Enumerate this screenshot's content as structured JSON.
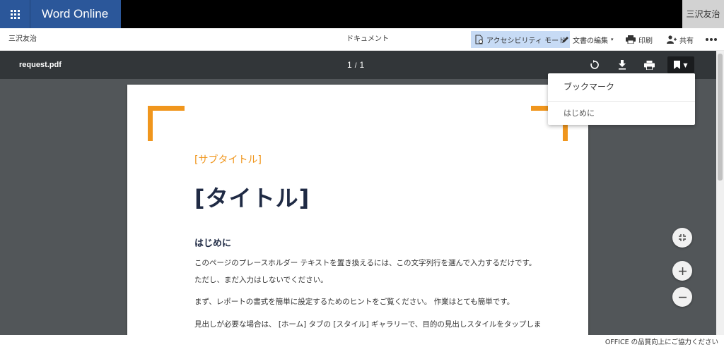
{
  "app": {
    "name": "Word Online",
    "user": "三沢友治"
  },
  "command_bar": {
    "user": "三沢友治",
    "document": "ドキュメント",
    "accessibility": "アクセシビリティ モード",
    "edit": "文書の編集",
    "print": "印刷",
    "share": "共有"
  },
  "viewer": {
    "filename": "request.pdf",
    "page_current": "1",
    "page_total": "1"
  },
  "document": {
    "subtitle": "[サブタイトル]",
    "title": "[タイトル]",
    "heading": "はじめに",
    "paragraphs": [
      "このページのプレースホルダー テキストを置き換えるには、この文字列行を選んで入力するだけです。",
      "ただし、まだ入力はしないでください。",
      "まず、レポートの書式を簡単に設定するためのヒントをご覧ください。 作業はとても簡単です。",
      "見出しが必要な場合は、 [ホーム] タブの [スタイル] ギャラリーで、目的の見出しスタイルをタップしま"
    ]
  },
  "bookmarks": {
    "title": "ブックマーク",
    "items": [
      "はじめに"
    ]
  },
  "status": {
    "feedback": "OFFICE の品質向上にご協力ください"
  },
  "colors": {
    "brand": "#2b579a",
    "accent": "#f0961d",
    "viewer_bg": "#525659",
    "toolbar_bg": "#323639"
  }
}
